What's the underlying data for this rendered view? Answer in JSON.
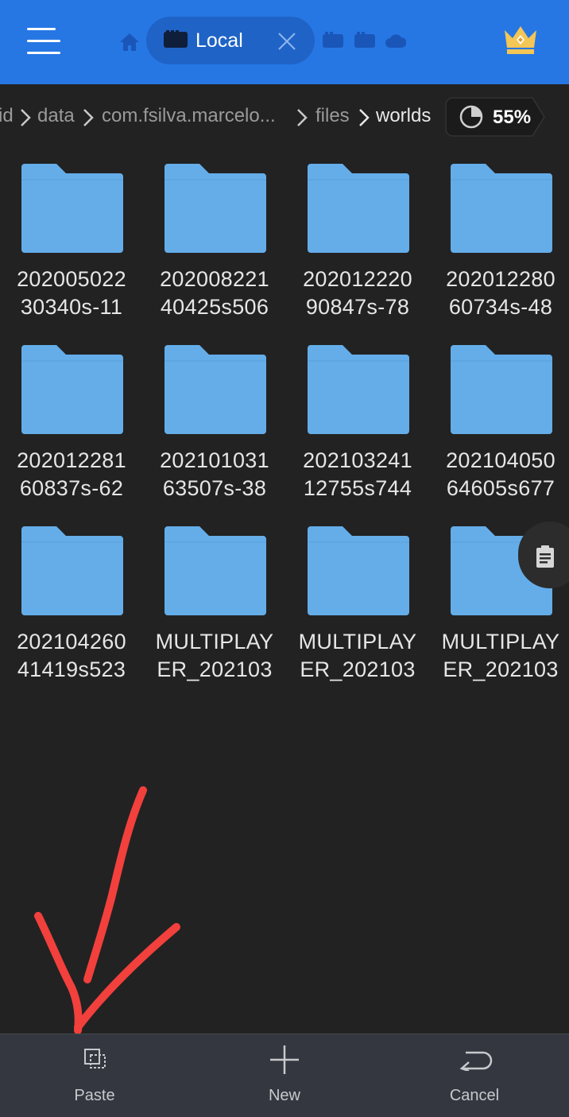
{
  "header": {
    "menu_icon": "hamburger-menu-icon",
    "home_icon": "home-icon",
    "local_tab_label": "Local",
    "tab_icons": [
      "sd-card-icon",
      "sd-card-icon",
      "cloud-icon"
    ],
    "premium_icon": "crown-icon",
    "colors": {
      "bar": "#2677e4",
      "tab": "#1f63c7"
    }
  },
  "breadcrumb": {
    "items": [
      "id",
      "data",
      "com.fsilva.marcelo...",
      "files",
      "worlds"
    ],
    "storage_percent": "55%"
  },
  "folders": [
    {
      "line1": "202005022",
      "line2": "30340s-11"
    },
    {
      "line1": "202008221",
      "line2": "40425s506"
    },
    {
      "line1": "202012220",
      "line2": "90847s-78"
    },
    {
      "line1": "202012280",
      "line2": "60734s-48"
    },
    {
      "line1": "202012281",
      "line2": "60837s-62"
    },
    {
      "line1": "202101031",
      "line2": "63507s-38"
    },
    {
      "line1": "202103241",
      "line2": "12755s744"
    },
    {
      "line1": "202104050",
      "line2": "64605s677"
    },
    {
      "line1": "202104260",
      "line2": "41419s523"
    },
    {
      "line1": "MULTIPLAY",
      "line2": "ER_202103"
    },
    {
      "line1": "MULTIPLAY",
      "line2": "ER_202103"
    },
    {
      "line1": "MULTIPLAY",
      "line2": "ER_202103"
    }
  ],
  "folder_color": "#64ade9",
  "bottom_bar": {
    "paste_label": "Paste",
    "new_label": "New",
    "cancel_label": "Cancel"
  },
  "annotation_color": "#f2403d"
}
